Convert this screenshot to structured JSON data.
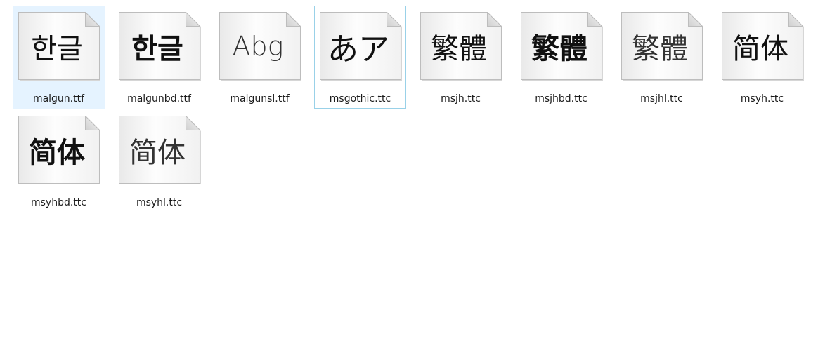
{
  "files": [
    {
      "name": "malgun.ttf",
      "preview": "한글",
      "weight": "regular",
      "state": "selected"
    },
    {
      "name": "malgunbd.ttf",
      "preview": "한글",
      "weight": "bold",
      "state": "none"
    },
    {
      "name": "malgunsl.ttf",
      "preview": "Abg",
      "weight": "latin",
      "state": "none"
    },
    {
      "name": "msgothic.ttc",
      "preview": "あア",
      "weight": "kana",
      "state": "focused"
    },
    {
      "name": "msjh.ttc",
      "preview": "繁體",
      "weight": "regular",
      "state": "none"
    },
    {
      "name": "msjhbd.ttc",
      "preview": "繁體",
      "weight": "bold",
      "state": "none"
    },
    {
      "name": "msjhl.ttc",
      "preview": "繁體",
      "weight": "light",
      "state": "none"
    },
    {
      "name": "msyh.ttc",
      "preview": "简体",
      "weight": "regular",
      "state": "none"
    },
    {
      "name": "msyhbd.ttc",
      "preview": "简体",
      "weight": "bold",
      "state": "none"
    },
    {
      "name": "msyhl.ttc",
      "preview": "简体",
      "weight": "light",
      "state": "none"
    }
  ]
}
